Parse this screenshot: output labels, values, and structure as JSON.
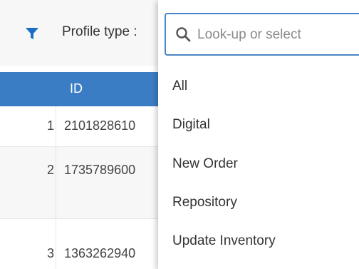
{
  "filter": {
    "label": "Profile type :",
    "icon": "filter-icon"
  },
  "search": {
    "placeholder": "Look-up or select",
    "icon": "search-icon"
  },
  "options": [
    "All",
    "Digital",
    "New Order",
    "Repository",
    "Update Inventory"
  ],
  "table": {
    "header_id": "ID",
    "rows": [
      {
        "num": "1",
        "id": "2101828610"
      },
      {
        "num": "2",
        "id": "1735789600"
      },
      {
        "num": "3",
        "id": "1363262940"
      }
    ]
  },
  "colors": {
    "accent": "#3b7dc4",
    "filter_icon": "#1a6fc4",
    "focus_border": "#4a86c5"
  }
}
